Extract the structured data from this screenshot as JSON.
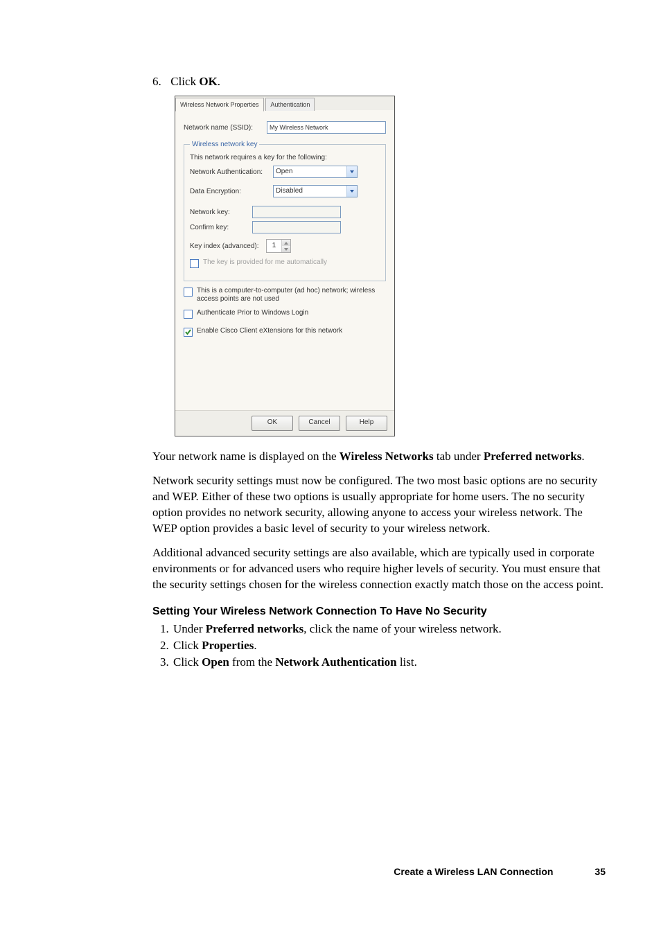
{
  "step6": {
    "num": "6.",
    "text_before": "Click ",
    "bold": "OK",
    "text_after": "."
  },
  "dialog": {
    "tabs": {
      "a": "Wireless Network Properties",
      "b": "Authentication"
    },
    "ssid": {
      "label": "Network name (SSID):",
      "value": "My Wireless Network"
    },
    "fieldset_legend": "Wireless network key",
    "requires": "This network requires a key for the following:",
    "auth": {
      "label": "Network Authentication:",
      "value": "Open"
    },
    "enc": {
      "label": "Data Encryption:",
      "value": "Disabled"
    },
    "netkey": {
      "label": "Network key:"
    },
    "confkey": {
      "label": "Confirm key:"
    },
    "keyidx": {
      "label": "Key index (advanced):",
      "value": "1"
    },
    "autokey": "The key is provided for me automatically",
    "adhoc": "This is a computer-to-computer (ad hoc) network; wireless access points are not used",
    "prewin": "Authenticate Prior to Windows Login",
    "cisco": "Enable Cisco Client eXtensions for this network",
    "buttons": {
      "ok": "OK",
      "cancel": "Cancel",
      "help": "Help"
    }
  },
  "para1": {
    "a": "Your network name is displayed on the ",
    "b": "Wireless Networks",
    "c": " tab under ",
    "d": "Preferred networks",
    "e": "."
  },
  "para2": "Network security settings must now be configured. The two most basic options are no security and WEP. Either of these two options is usually appropriate for home users. The no security option provides no network security, allowing anyone to access your wireless network. The WEP option provides a basic level of security to your wireless network.",
  "para3": "Additional advanced security settings are also available, which are typically used in corporate environments or for advanced users who require higher levels of security. You must ensure that the security settings chosen for the wireless connection exactly match those on the access point.",
  "subheading": "Setting Your Wireless Network Connection To Have No Security",
  "steps": {
    "s1a": "Under ",
    "s1b": "Preferred networks",
    "s1c": ", click the name of your wireless network.",
    "s2a": "Click ",
    "s2b": "Properties",
    "s2c": ".",
    "s3a": "Click ",
    "s3b": "Open",
    "s3c": " from the ",
    "s3d": "Network Authentication",
    "s3e": " list."
  },
  "footer": {
    "title": "Create a Wireless LAN Connection",
    "page": "35"
  }
}
